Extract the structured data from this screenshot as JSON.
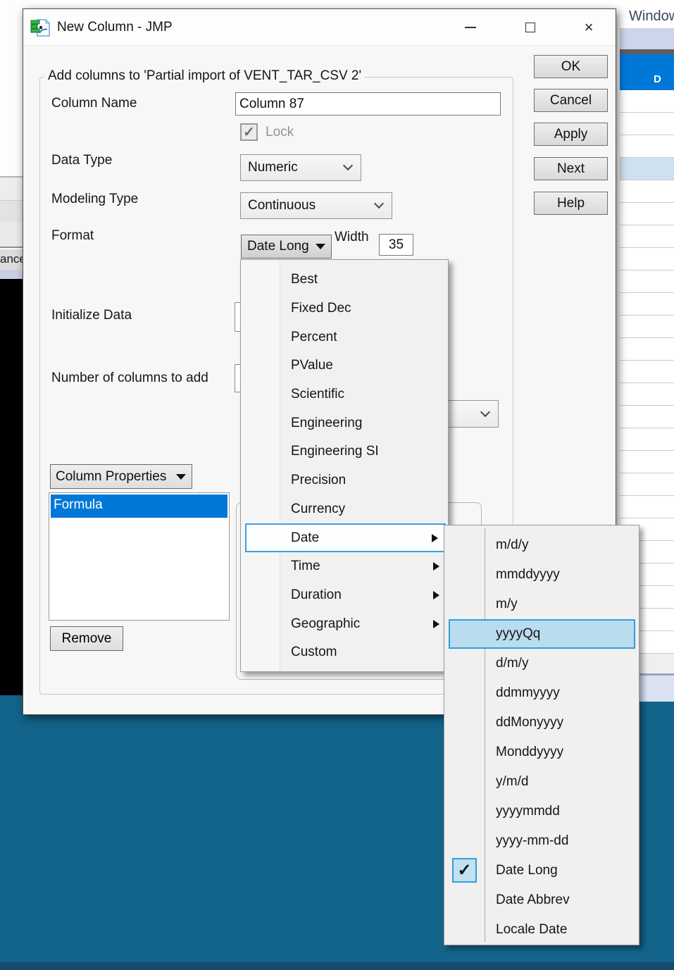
{
  "window": {
    "title": "New Column - JMP",
    "app_icon": "jmp-new-column-icon"
  },
  "background": {
    "window_menu_label": "Window",
    "table_header_partial": "D",
    "partial_button_text": "ance",
    "table": {
      "row_count": 25,
      "highlighted_row": 3
    }
  },
  "dialog": {
    "group_title": "Add columns to 'Partial import of VENT_TAR_CSV 2'",
    "fields": {
      "column_name": {
        "label": "Column Name",
        "value": "Column 87"
      },
      "lock": {
        "label": "Lock",
        "checked": true
      },
      "data_type": {
        "label": "Data Type",
        "value": "Numeric"
      },
      "modeling_type": {
        "label": "Modeling Type",
        "value": "Continuous"
      },
      "format": {
        "label": "Format",
        "value": "Date Long",
        "width_label": "Width",
        "width_value": "35"
      },
      "initialize_data": {
        "label": "Initialize Data"
      },
      "num_columns": {
        "label": "Number of columns to add"
      }
    },
    "column_properties": {
      "button_label": "Column Properties",
      "list_selected": "Formula",
      "remove_label": "Remove"
    },
    "action_buttons": [
      {
        "label": "OK"
      },
      {
        "label": "Cancel"
      },
      {
        "label": "Apply"
      },
      {
        "label": "Next"
      },
      {
        "label": "Help"
      }
    ]
  },
  "format_menu": {
    "items": [
      {
        "label": "Best"
      },
      {
        "label": "Fixed Dec"
      },
      {
        "label": "Percent"
      },
      {
        "label": "PValue"
      },
      {
        "label": "Scientific"
      },
      {
        "label": "Engineering"
      },
      {
        "label": "Engineering SI"
      },
      {
        "label": "Precision"
      },
      {
        "label": "Currency"
      },
      {
        "label": "Date",
        "submenu": true,
        "highlighted": true
      },
      {
        "label": "Time",
        "submenu": true
      },
      {
        "label": "Duration",
        "submenu": true
      },
      {
        "label": "Geographic",
        "submenu": true
      },
      {
        "label": "Custom"
      }
    ]
  },
  "date_submenu": {
    "items": [
      {
        "label": "m/d/y"
      },
      {
        "label": "mmddyyyy"
      },
      {
        "label": "m/y"
      },
      {
        "label": "yyyyQq",
        "highlighted": true
      },
      {
        "label": "d/m/y"
      },
      {
        "label": "ddmmyyyy"
      },
      {
        "label": "ddMonyyyy"
      },
      {
        "label": "Monddyyyy"
      },
      {
        "label": "y/m/d"
      },
      {
        "label": "yyyymmdd"
      },
      {
        "label": "yyyy-mm-dd"
      },
      {
        "label": "Date Long",
        "checked": true
      },
      {
        "label": "Date Abbrev"
      },
      {
        "label": "Locale Date"
      }
    ]
  },
  "colors": {
    "accent_blue": "#0078d7",
    "menu_highlight_border": "#2f9fd8",
    "menu_highlight_fill": "#b9dcee",
    "selected_table_row": "#cfe1f1",
    "teal_background": "#12648b",
    "bottom_band": "#17496e"
  }
}
